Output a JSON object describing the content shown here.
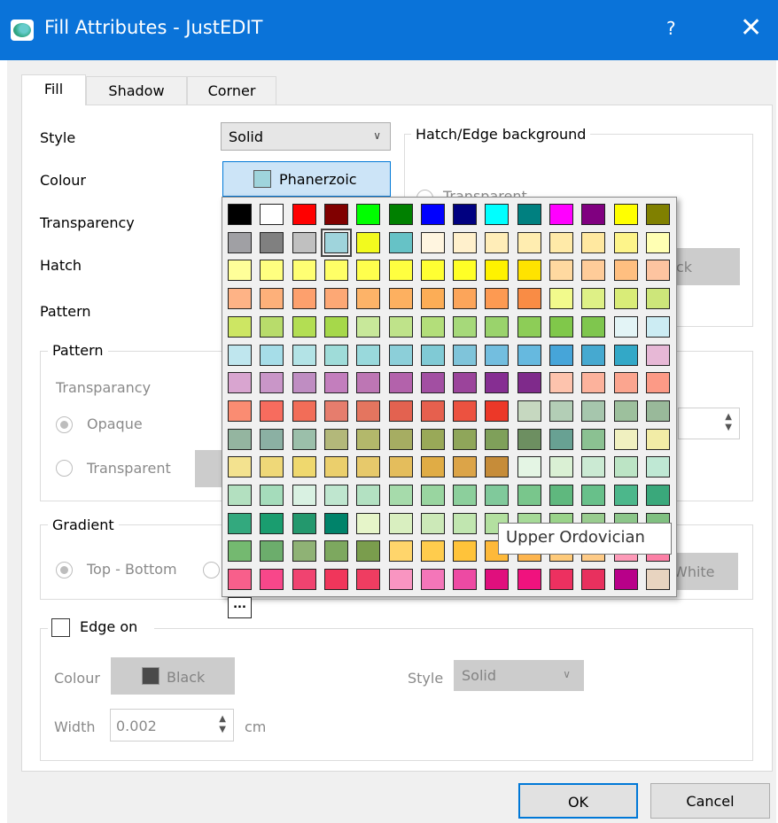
{
  "window": {
    "title": "Fill Attributes - JustEDIT",
    "help_label": "?",
    "close_label": "✕"
  },
  "tabs": [
    {
      "label": "Fill",
      "active": true
    },
    {
      "label": "Shadow",
      "active": false
    },
    {
      "label": "Corner",
      "active": false
    }
  ],
  "fill": {
    "style_label": "Style",
    "style_value": "Solid",
    "colour_label": "Colour",
    "colour_value": "Phanerzoic",
    "colour_swatch": "#9fd4dc",
    "transparency_label": "Transparency",
    "hatch_label": "Hatch",
    "pattern_label": "Pattern"
  },
  "hatch_edge_group": {
    "title": "Hatch/Edge background",
    "transparent_label": "Transparent",
    "colour_button_label": "ck"
  },
  "pattern_group": {
    "title": "Pattern",
    "transparancy_label": "Transparancy",
    "opaque_label": "Opaque",
    "transparent_label": "Transparent"
  },
  "gradient_group": {
    "title": "Gradient",
    "top_bottom_label": "Top - Bottom",
    "white_button_label": "White"
  },
  "edge_group": {
    "edge_on_label": "Edge on",
    "colour_label": "Colour",
    "colour_button_label": "Black",
    "colour_swatch": "#4a4a4a",
    "style_label": "Style",
    "style_value": "Solid",
    "width_label": "Width",
    "width_value": "0.002",
    "width_unit": "cm"
  },
  "palette": {
    "more_label": "...",
    "selected_index": 17,
    "colors": [
      "#000000",
      "#ffffff",
      "#ff0000",
      "#800000",
      "#00ff00",
      "#008000",
      "#0000ff",
      "#000080",
      "#00ffff",
      "#008080",
      "#ff00ff",
      "#800080",
      "#ffff00",
      "#808000",
      "#a0a0a4",
      "#808080",
      "#c0c0c0",
      "#9fd4dc",
      "#f2fa1e",
      "#66c2c6",
      "#fff5e0",
      "#fff0cc",
      "#ffedb8",
      "#ffedb0",
      "#ffeaa8",
      "#ffe8a0",
      "#fdf48a",
      "#ffffb3",
      "#ffff99",
      "#ffff80",
      "#ffff73",
      "#ffff66",
      "#ffff4d",
      "#ffff40",
      "#ffff33",
      "#ffff26",
      "#fff200",
      "#ffe300",
      "#ffd9a0",
      "#ffcc99",
      "#ffbf80",
      "#fdc4a0",
      "#feb386",
      "#fdb07a",
      "#fda06d",
      "#fda875",
      "#fdb368",
      "#fdb060",
      "#fcad56",
      "#fca55a",
      "#fd9a52",
      "#f98c45",
      "#f2fa8c",
      "#def086",
      "#d9ec78",
      "#cde67a",
      "#cde663",
      "#b8dc6b",
      "#b3de53",
      "#a6d84a",
      "#c8e89a",
      "#bfe38a",
      "#b3de7a",
      "#a6d97a",
      "#9ad36c",
      "#8dcd57",
      "#80c84a",
      "#7fc64e",
      "#e3f4f6",
      "#ccecf3",
      "#bfe6ee",
      "#a6dde8",
      "#b3e3e6",
      "#9fdcd9",
      "#99d9dc",
      "#8ccfd9",
      "#80cad5",
      "#7fc4da",
      "#73bedf",
      "#66b9df",
      "#46a5d9",
      "#46a9d0",
      "#33a8c7",
      "#e7b8d6",
      "#d9a5d0",
      "#c996c8",
      "#bf8dc2",
      "#c37ebd",
      "#bd76b4",
      "#b362ab",
      "#a24fa2",
      "#9b449b",
      "#862e92",
      "#7f2a8b",
      "#fdc3ad",
      "#fcb29c",
      "#fba58f",
      "#fc9a86",
      "#fa8c72",
      "#f76c5e",
      "#f26d58",
      "#e67d6d",
      "#e4755f",
      "#e36250",
      "#e6604e",
      "#ec5240",
      "#ec3828",
      "#c6d8c0",
      "#b3ceb6",
      "#a6c6ad",
      "#9dc09d",
      "#99b99a",
      "#94b5a0",
      "#8bb0a3",
      "#9bbfaa",
      "#b3b87a",
      "#b3b86b",
      "#a6ad62",
      "#99a958",
      "#8fa65a",
      "#7fa05a",
      "#6d8f61",
      "#68a193",
      "#8bc192",
      "#f0f0c0",
      "#f2eca6",
      "#f3e28f",
      "#efd878",
      "#efd86e",
      "#ebcf6c",
      "#e7c96b",
      "#e4bd5c",
      "#e0ac45",
      "#dca448",
      "#c68c39",
      "#e4f5e4",
      "#daf0d4",
      "#cbead3",
      "#bce4c5",
      "#bfe8d4",
      "#b3e0c0",
      "#a5dcbb",
      "#d9f1e2",
      "#bfe6cf",
      "#b3e1c2",
      "#a6dbab",
      "#99d5a0",
      "#8ccf9c",
      "#80c99b",
      "#79c68c",
      "#5fb87e",
      "#68c08a",
      "#4cb78b",
      "#3aa87b",
      "#33a97e",
      "#1a9d6f",
      "#23986d",
      "#00836a",
      "#e6f5c9",
      "#d9efc0",
      "#cce9b8",
      "#c1e6b0",
      "#b3e0a0",
      "#a6da98",
      "#9ad38a",
      "#99cc8f",
      "#8cc68a",
      "#80c081",
      "#74b970",
      "#6cad6c",
      "#8fb275",
      "#7da85f",
      "#7a9d4d",
      "#ffd56b",
      "#ffcc4d",
      "#ffc33a",
      "#feb93a",
      "#fdb54f",
      "#feca7a",
      "#fecb87",
      "#fd9ab8",
      "#fc80a6",
      "#f85f8b",
      "#f8478a",
      "#f04370",
      "#f0365b",
      "#ef3d61",
      "#f995c1",
      "#f476b9",
      "#ed4aa3",
      "#e00f7d",
      "#f0127e",
      "#ed3060",
      "#e8305e",
      "#b80089",
      "#e8d4c0"
    ]
  },
  "tooltip": {
    "text": "Upper Ordovician"
  },
  "footer": {
    "ok_label": "OK",
    "cancel_label": "Cancel"
  }
}
